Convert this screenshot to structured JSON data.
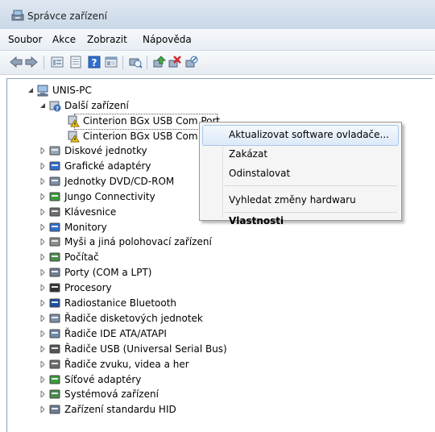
{
  "window": {
    "title": "Správce zařízení"
  },
  "menu": [
    "Soubor",
    "Akce",
    "Zobrazit",
    "Nápověda"
  ],
  "toolbar": [
    "back-icon",
    "forward-icon",
    "properties-view-icon",
    "show-hidden-icon",
    "help-icon",
    "console-tree-icon",
    "scan-hardware-icon",
    "update-driver-icon",
    "uninstall-icon",
    "disable-icon"
  ],
  "tree": {
    "root": "UNIS-PC",
    "other": "Další zařízení",
    "other_children": [
      "Cinterion BGx USB Com Port",
      "Cinterion BGx USB Com P"
    ],
    "categories": [
      "Diskové jednotky",
      "Grafické adaptéry",
      "Jednotky DVD/CD-ROM",
      "Jungo Connectivity",
      "Klávesnice",
      "Monitory",
      "Myši a jiná polohovací zařízení",
      "Počítač",
      "Porty (COM a LPT)",
      "Procesory",
      "Radiostanice Bluetooth",
      "Řadiče disketových jednotek",
      "Řadiče IDE ATA/ATAPI",
      "Řadiče USB (Universal Serial Bus)",
      "Řadiče zvuku, videa a her",
      "Síťové adaptéry",
      "Systémová zařízení",
      "Zařízení standardu HID"
    ]
  },
  "context_menu": {
    "update_driver": "Aktualizovat software ovladače...",
    "disable": "Zakázat",
    "uninstall": "Odinstalovat",
    "scan": "Vyhledat změny hardwaru",
    "properties": "Vlastnosti"
  }
}
